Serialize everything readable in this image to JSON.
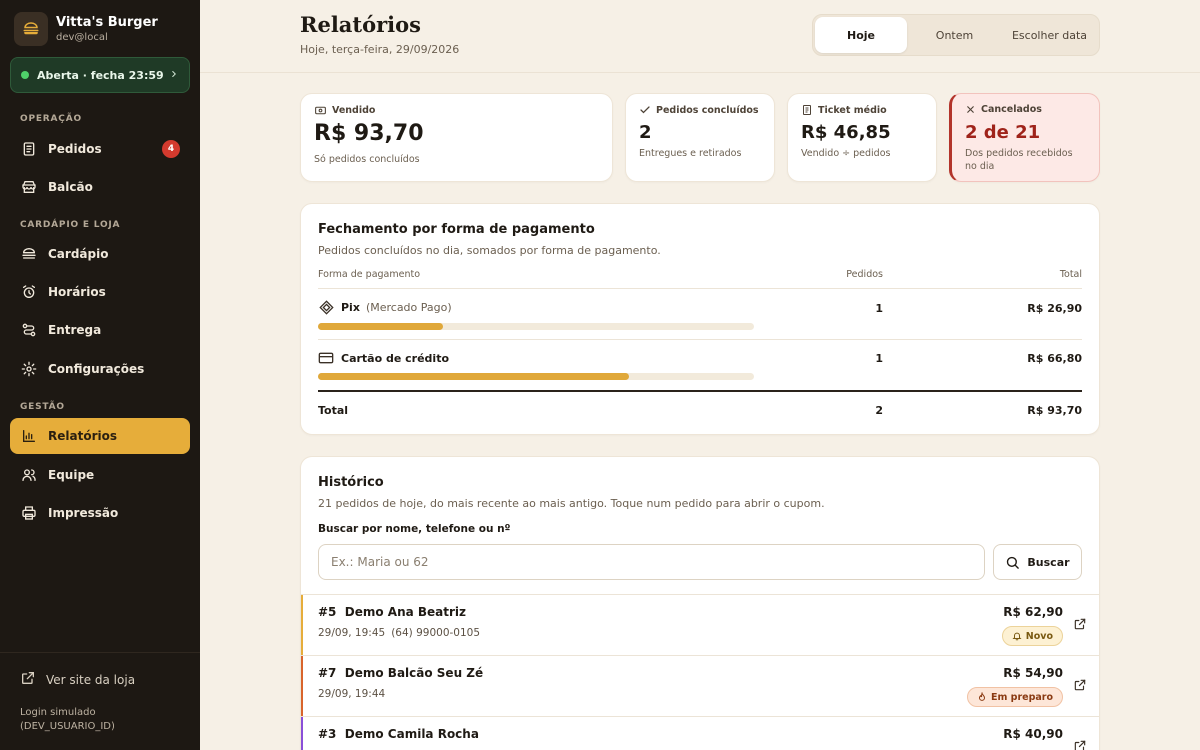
{
  "brand": {
    "name": "Vitta's Burger",
    "user": "dev@local"
  },
  "store_status": {
    "label": "Aberta · fecha 23:59",
    "color": "#4fd06a"
  },
  "sidebar": {
    "sections": [
      {
        "title": "OPERAÇÃO",
        "items": [
          {
            "label": "Pedidos",
            "icon": "document-icon",
            "badge": "4"
          },
          {
            "label": "Balcão",
            "icon": "store-icon"
          }
        ]
      },
      {
        "title": "CARDÁPIO E LOJA",
        "items": [
          {
            "label": "Cardápio",
            "icon": "burger-icon"
          },
          {
            "label": "Horários",
            "icon": "alarm-clock-icon"
          },
          {
            "label": "Entrega",
            "icon": "route-icon"
          },
          {
            "label": "Configurações",
            "icon": "gear-icon"
          }
        ]
      },
      {
        "title": "GESTÃO",
        "items": [
          {
            "label": "Relatórios",
            "icon": "bar-chart-icon",
            "active": true
          },
          {
            "label": "Equipe",
            "icon": "users-icon"
          },
          {
            "label": "Impressão",
            "icon": "printer-icon"
          }
        ]
      }
    ],
    "site_link": "Ver site da loja",
    "login_note_line1": "Login simulado",
    "login_note_line2": "(DEV_USUARIO_ID)"
  },
  "header": {
    "title": "Relatórios",
    "subtitle": "Hoje, terça-feira, 29/09/2026",
    "date_options": [
      "Hoje",
      "Ontem",
      "Escolher data"
    ],
    "selected_option": "Hoje"
  },
  "kpis": [
    {
      "label": "Vendido",
      "icon": "cash-icon",
      "value": "R$ 93,70",
      "note": "Só pedidos concluídos"
    },
    {
      "label": "Pedidos concluídos",
      "icon": "check-icon",
      "value": "2",
      "note": "Entregues e retirados"
    },
    {
      "label": "Ticket médio",
      "icon": "receipt-icon",
      "value": "R$ 46,85",
      "note": "Vendido ÷ pedidos"
    },
    {
      "label": "Cancelados",
      "icon": "x-icon",
      "value": "2 de 21",
      "note_line1": "Dos pedidos recebidos",
      "note_line2": "no dia"
    }
  ],
  "payments": {
    "title": "Fechamento por forma de pagamento",
    "subtitle": "Pedidos concluídos no dia, somados por forma de pagamento.",
    "columns": [
      "Forma de pagamento",
      "Pedidos",
      "Total"
    ],
    "rows": [
      {
        "name": "Pix",
        "detail": "(Mercado Pago)",
        "icon": "pix-icon",
        "orders": "1",
        "total": "R$ 26,90",
        "share": 0.287
      },
      {
        "name": "Cartão de crédito",
        "detail": "",
        "icon": "credit-card-icon",
        "orders": "1",
        "total": "R$ 66,80",
        "share": 0.713
      }
    ],
    "total_row": {
      "label": "Total",
      "orders": "2",
      "total": "R$ 93,70"
    },
    "bar_color": "#e0a83a"
  },
  "history": {
    "title": "Histórico",
    "subtitle": "21 pedidos de hoje, do mais recente ao mais antigo. Toque num pedido para abrir o cupom.",
    "search_label": "Buscar por nome, telefone ou nº",
    "search_placeholder": "Ex.: Maria ou 62",
    "search_value": "",
    "search_button": "Buscar",
    "orders": [
      {
        "number": "#5",
        "name": "Demo Ana Beatriz",
        "datetime": "29/09, 19:45",
        "phone": "(64) 99000-0105",
        "total": "R$ 62,90",
        "status": "Novo",
        "status_icon": "bell-icon",
        "accent": "#e6ad3a",
        "chip_bg": "#fdf1d3",
        "chip_fg": "#7a5a12",
        "chip_border": "#ecd39a"
      },
      {
        "number": "#7",
        "name": "Demo Balcão Seu Zé",
        "datetime": "29/09, 19:44",
        "phone": "",
        "total": "R$ 54,90",
        "status": "Em preparo",
        "status_icon": "flame-icon",
        "accent": "#d9642b",
        "chip_bg": "#fde6d8",
        "chip_fg": "#8a3a12",
        "chip_border": "#f1c2a4"
      },
      {
        "number": "#3",
        "name": "Demo Camila Rocha",
        "datetime": "",
        "phone": "",
        "total": "R$ 40,90",
        "status": "",
        "status_icon": "",
        "accent": "#8a4fd8",
        "chip_bg": "#eee6fb",
        "chip_fg": "#4b2a86",
        "chip_border": "#d6c6f4"
      }
    ]
  }
}
